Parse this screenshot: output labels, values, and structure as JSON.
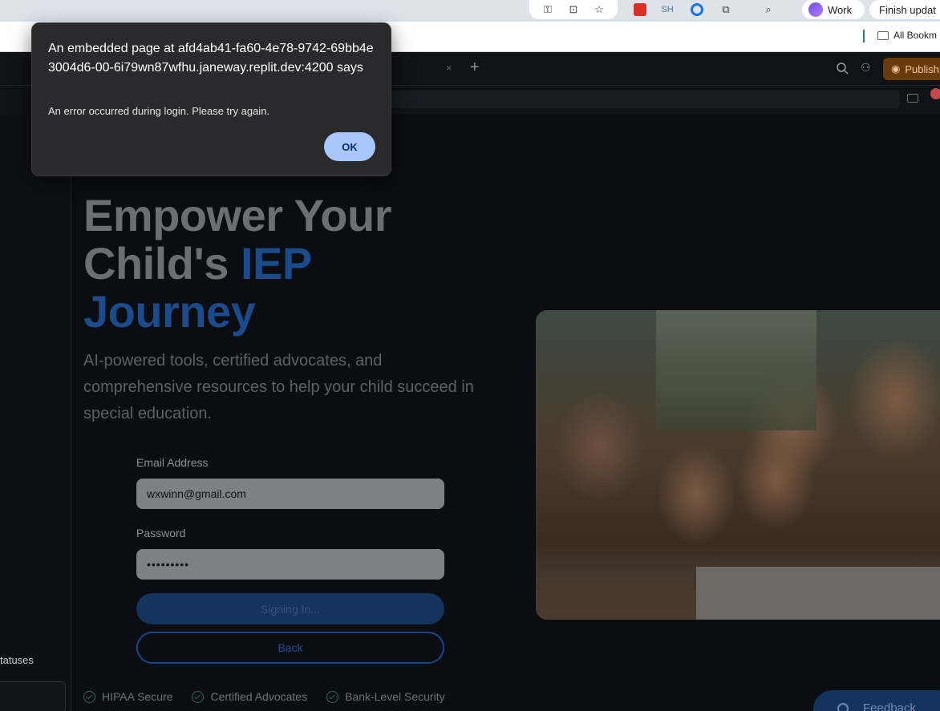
{
  "browser": {
    "profile_name": "Work",
    "update_label": "Finish updat",
    "bookmarks_label": "All Bookm",
    "ext_sh_label": "SH",
    "icons": [
      "key-icon",
      "install-app-icon",
      "star-icon",
      "extension-red-icon",
      "extension-sh-icon",
      "extension-c-icon",
      "puzzle-icon",
      "tab-search-icon"
    ]
  },
  "ide": {
    "publish_label": "Publish",
    "close_glyph": "×",
    "plus_glyph": "+",
    "sidebar_statuses": "tatuses"
  },
  "dialog": {
    "title": "An embedded page at afd4ab41-fa60-4e78-9742-69bb4e3004d6-00-6i79wn87wfhu.janeway.replit.dev:4200 says",
    "message": "An error occurred during login. Please try again.",
    "ok_label": "OK"
  },
  "hero": {
    "title_line1": "Empower Your",
    "title_line2_plain": "Child's ",
    "title_line2_accent": "IEP",
    "title_line3_accent": "Journey",
    "subtitle": "AI-powered tools, certified advocates, and comprehensive resources to help your child succeed in special education."
  },
  "login_form": {
    "email_label": "Email Address",
    "email_value": "wxwinn@gmail.com",
    "password_label": "Password",
    "password_value": "•••••••••",
    "signin_label": "Signing In...",
    "back_label": "Back"
  },
  "trust_badges": [
    "HIPAA Secure",
    "Certified Advocates",
    "Bank-Level Security"
  ],
  "feedback_label": "Feedback",
  "colors": {
    "accent_blue": "#1b4b8a",
    "ok_button": "#a8c7fa",
    "publish": "#6b3a0a"
  }
}
